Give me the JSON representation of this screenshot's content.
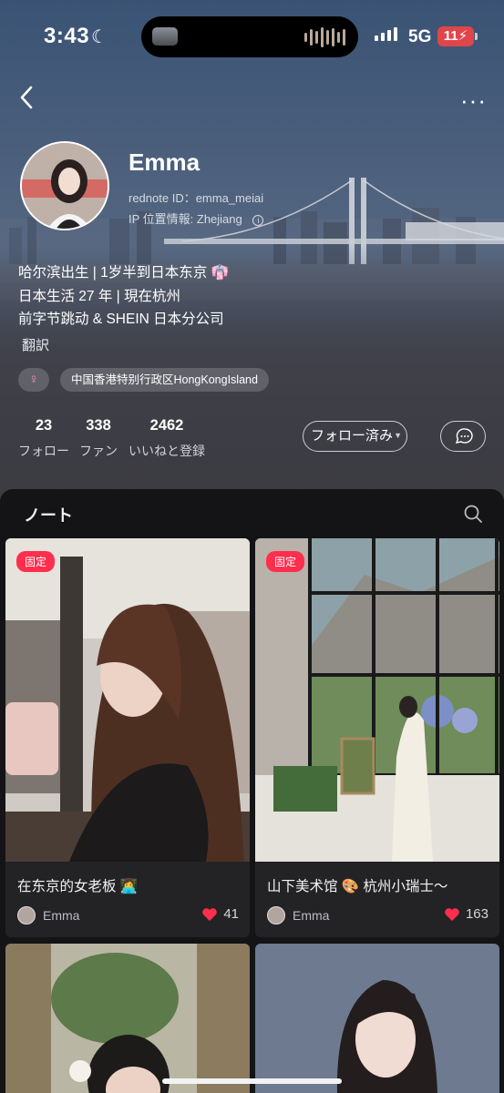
{
  "status_bar": {
    "time": "3:43",
    "network": "5G",
    "battery": "11"
  },
  "profile": {
    "name": "Emma",
    "rednote_id": "rednote ID：emma_meiai",
    "ip_location": "IP 位置情報: Zhejiang",
    "bio_lines": [
      "哈尔滨出生 | 1岁半到日本东京 👘",
      "日本生活 27 年 | 現在杭州",
      "前字节跳动 & SHEIN 日本分公司"
    ],
    "translate_label": "翻訳",
    "gender_icon": "♀",
    "location_tag": "中国香港特别行政区HongKongIsland",
    "stats": [
      {
        "value": "23",
        "label": "フォロー"
      },
      {
        "value": "338",
        "label": "ファン"
      },
      {
        "value": "2462",
        "label": "いいねと登録"
      }
    ],
    "follow_button": "フォロー済み",
    "accent_color": "#ff2e4d"
  },
  "notes": {
    "title": "ノート",
    "pinned_label": "固定",
    "cards": [
      {
        "title": "在东京的女老板 👩‍💻",
        "author": "Emma",
        "likes": "41"
      },
      {
        "title": "山下美术馆 🎨 杭州小瑞士〜",
        "author": "Emma",
        "likes": "163"
      }
    ]
  }
}
